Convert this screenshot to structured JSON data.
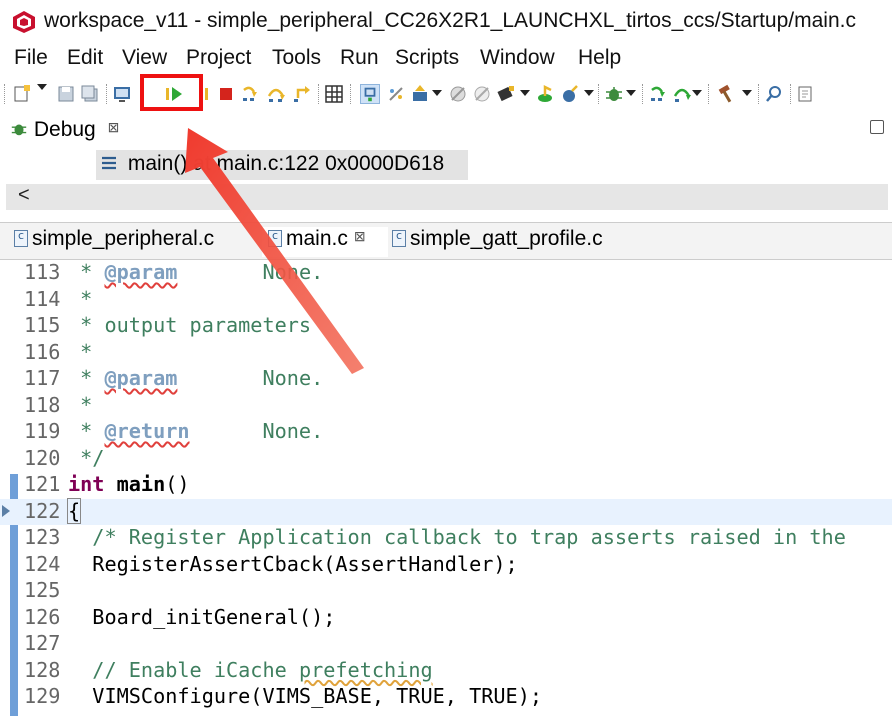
{
  "window": {
    "title": "workspace_v11 - simple_peripheral_CC26X2R1_LAUNCHXL_tirtos_ccs/Startup/main.c"
  },
  "menu": [
    "File",
    "Edit",
    "View",
    "Project",
    "Tools",
    "Run",
    "Scripts",
    "Window",
    "Help"
  ],
  "toolbar": {
    "highlighted_button": "resume-icon",
    "accent_color": "#e11111"
  },
  "debug_view": {
    "tab_label": "Debug",
    "tab_close": "⊠",
    "stack_frame": "main() at main.c:122 0x0000D618",
    "scroll_left": "<"
  },
  "editor": {
    "tabs": [
      {
        "label": "simple_peripheral.c",
        "active": false
      },
      {
        "label": "main.c",
        "active": true,
        "close": "⊠"
      },
      {
        "label": "simple_gatt_profile.c",
        "active": false
      }
    ],
    "lines": [
      {
        "n": "113",
        "parts": [
          [
            " * ",
            "cmt"
          ],
          [
            "@param",
            "tag"
          ],
          [
            "       None.",
            "cmt"
          ]
        ]
      },
      {
        "n": "114",
        "parts": [
          [
            " *",
            "cmt"
          ]
        ]
      },
      {
        "n": "115",
        "parts": [
          [
            " * output parameters",
            "cmt"
          ]
        ]
      },
      {
        "n": "116",
        "parts": [
          [
            " *",
            "cmt"
          ]
        ]
      },
      {
        "n": "117",
        "parts": [
          [
            " * ",
            "cmt"
          ],
          [
            "@param",
            "tag"
          ],
          [
            "       None.",
            "cmt"
          ]
        ]
      },
      {
        "n": "118",
        "parts": [
          [
            " *",
            "cmt"
          ]
        ]
      },
      {
        "n": "119",
        "parts": [
          [
            " * ",
            "cmt"
          ],
          [
            "@return",
            "tag"
          ],
          [
            "      None.",
            "cmt"
          ]
        ]
      },
      {
        "n": "120",
        "parts": [
          [
            " */",
            "cmt"
          ]
        ]
      },
      {
        "n": "121",
        "parts": [
          [
            "int",
            "kw"
          ],
          [
            " ",
            ""
          ],
          [
            "main",
            "fn"
          ],
          [
            "()",
            ""
          ]
        ]
      },
      {
        "n": "122",
        "parts": [
          [
            "{",
            "brace"
          ]
        ],
        "current": true
      },
      {
        "n": "123",
        "parts": [
          [
            "  /* Register Application callback to trap asserts raised in the",
            "cmt"
          ]
        ]
      },
      {
        "n": "124",
        "parts": [
          [
            "  RegisterAssertCback(AssertHandler);",
            ""
          ]
        ]
      },
      {
        "n": "125",
        "parts": [
          [
            "",
            ""
          ]
        ]
      },
      {
        "n": "126",
        "parts": [
          [
            "  Board_initGeneral();",
            ""
          ]
        ]
      },
      {
        "n": "127",
        "parts": [
          [
            "",
            ""
          ]
        ]
      },
      {
        "n": "128",
        "parts": [
          [
            "  // Enable iCache ",
            "cmt"
          ],
          [
            "prefetching",
            "cmt squig"
          ]
        ]
      },
      {
        "n": "129",
        "parts": [
          [
            "  VIMSConfigure(VIMS_BASE, TRUE, TRUE);",
            ""
          ]
        ]
      }
    ]
  }
}
